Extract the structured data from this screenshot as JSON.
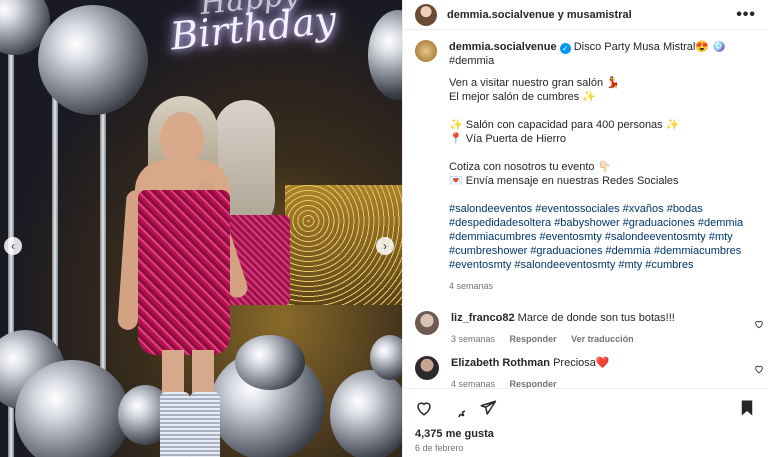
{
  "header": {
    "title": "demmia.socialvenue y musamistral",
    "more_label": "•••"
  },
  "photo": {
    "neon_text": "Birthday",
    "neon_top": "Happy",
    "prev_arrow": "‹",
    "next_arrow": "›"
  },
  "caption": {
    "username": "demmia.socialvenue",
    "verified_mark": "✓",
    "lines": [
      "Disco Party Musa Mistral😍 🪩 #demmia",
      "Ven a visitar nuestro gran salón 💃",
      "El mejor salón de cumbres ✨",
      "",
      "✨ Salón con capacidad para 400 personas ✨",
      "📍 Vía Puerta de Hierro",
      "",
      "Cotiza con nosotros tu evento 👇🏻",
      "💌 Envía mensaje en nuestras Redes Sociales",
      "",
      "#salondeeventos #eventossociales #xvaños #bodas",
      "#despedidadesoltera #babyshower #graduaciones #demmia",
      "#demmiacumbres #eventosmty #salondeeventosmty #mty",
      "#cumbreshower #graduaciones #demmia #demmiacumbres",
      "#eventosmty #salondeeventosmty #mty #cumbres"
    ],
    "time": "4 semanas"
  },
  "comments": [
    {
      "username": "liz_franco82",
      "text": "Marce de donde son tus botas!!!",
      "time": "3 semanas",
      "reply": "Responder",
      "translate": "Ver traducción"
    },
    {
      "username": "Elizabeth Rothman",
      "text": "Preciosa❤️",
      "time": "4 semanas",
      "reply": "Responder"
    }
  ],
  "footer": {
    "likes": "4,375 me gusta",
    "date": "6 de febrero"
  },
  "icons": {
    "like": "heart-icon",
    "comment": "comment-icon",
    "share": "share-icon",
    "save": "bookmark-icon"
  }
}
